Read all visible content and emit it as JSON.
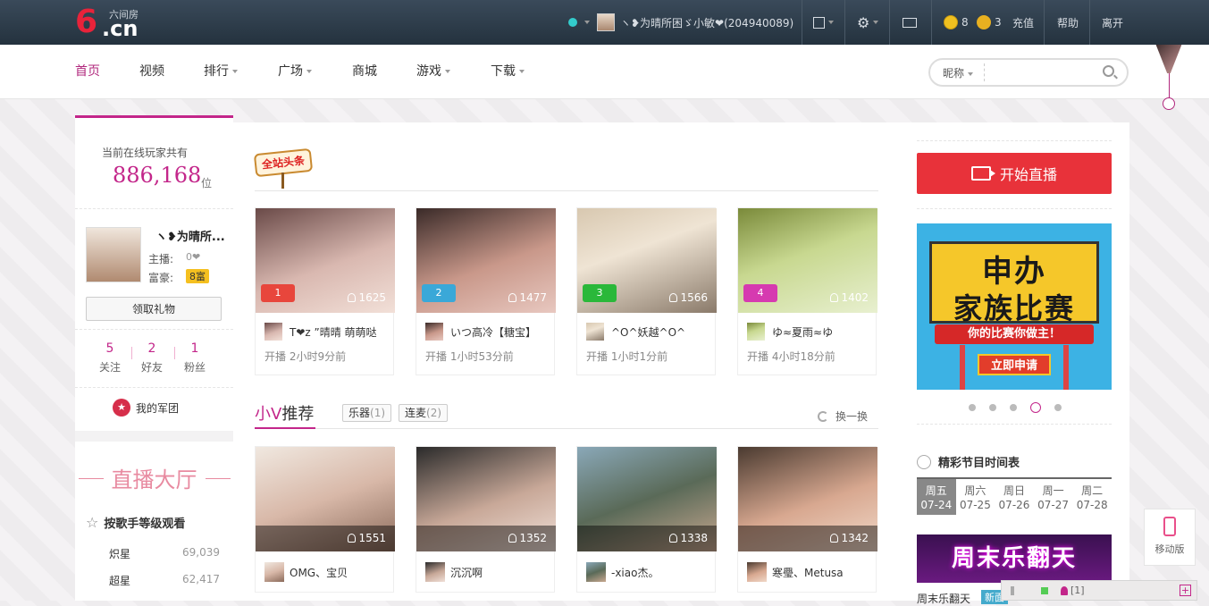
{
  "topbar": {
    "logo_big": "6",
    "logo_domain": ".cn",
    "logo_tag": "六间房",
    "username": "ヽ❥为晴所困ゞ小敏❤(204940089)",
    "coins": "8",
    "oranges": "3",
    "recharge": "充值",
    "help": "帮助",
    "leave": "离开"
  },
  "nav": {
    "items": [
      "首页",
      "视频",
      "排行",
      "广场",
      "商城",
      "游戏",
      "下载"
    ],
    "search_select": "昵称",
    "search_placeholder": ""
  },
  "left": {
    "online_label": "当前在线玩家共有",
    "online_count": "886,168",
    "online_unit": "位",
    "user_name": "ヽ❥为晴所...",
    "role_host": "主播:",
    "role_rich": "富豪:",
    "host_level": "0❤",
    "rich_level": "8富",
    "gift_button": "领取礼物",
    "follow_count": "5",
    "follow_label": "关注",
    "friend_count": "2",
    "friend_label": "好友",
    "fan_count": "1",
    "fan_label": "粉丝",
    "army": "我的军团",
    "hall_title": "直播大厅",
    "rank_title": "按歌手等级观看",
    "ranks": [
      {
        "name": "炽星",
        "value": "69,039"
      },
      {
        "name": "超星",
        "value": "62,417"
      }
    ]
  },
  "center": {
    "headline_badge": "全站头条",
    "headline_cards": [
      {
        "rank": "1",
        "viewers": "1625",
        "name": "T❤z ”晴晴 萌萌哒",
        "time": "开播 2小时9分前",
        "rank_color": "#e8463c",
        "img": "linear-gradient(160deg,#6a4a48,#d9b8b0 55%,#f2e0d8)"
      },
      {
        "rank": "2",
        "viewers": "1477",
        "name": "いつ高冷【糖宝】",
        "time": "开播 1小时53分前",
        "rank_color": "#3aa8d8",
        "img": "linear-gradient(160deg,#3a2a28,#c9988a 55%,#e8c8c0)"
      },
      {
        "rank": "3",
        "viewers": "1566",
        "name": "^O^妖越^O^",
        "time": "开播 1小时1分前",
        "rank_color": "#2ab83a",
        "img": "linear-gradient(160deg,#d8c8b0,#efe4d4 40%,#8a7a6a)"
      },
      {
        "rank": "4",
        "viewers": "1402",
        "name": "ゆ≈夏雨≈ゆ",
        "time": "开播 4小时18分前",
        "rank_color": "#d63ab0",
        "img": "linear-gradient(160deg,#7a8a3a,#c8d890 45%,#e8f0d0)"
      }
    ],
    "xv_title_a": "小V",
    "xv_title_b": "推荐",
    "tag1": "乐器",
    "tag1_count": "(1)",
    "tag2": "连麦",
    "tag2_count": "(2)",
    "refresh": "换一换",
    "xv_cards": [
      {
        "viewers": "1551",
        "name": "OMG、宝贝",
        "img": "linear-gradient(160deg,#f0e8e0,#d8b8a8 50%,#8a6a5a)"
      },
      {
        "viewers": "1352",
        "name": "沉沉啊",
        "img": "linear-gradient(160deg,#2a2a2a,#c8a898 55%,#f0e0d8)"
      },
      {
        "viewers": "1338",
        "name": "-xiao杰。",
        "img": "linear-gradient(160deg,#8aa8b8,#5a6a58 50%,#c8a890)"
      },
      {
        "viewers": "1342",
        "name": "寒璺、Metusa",
        "img": "linear-gradient(160deg,#4a3a30,#d8a890 55%,#f0d8c8)"
      }
    ]
  },
  "right": {
    "live_button": "开始直播",
    "banner_line1": "申办",
    "banner_line2": "家族比赛",
    "banner_ribbon": "你的比赛你做主！",
    "banner_apply": "立即申请",
    "schedule_title": "精彩节目时间表",
    "days": [
      {
        "week": "周五",
        "date": "07-24"
      },
      {
        "week": "周六",
        "date": "07-25"
      },
      {
        "week": "周日",
        "date": "07-26"
      },
      {
        "week": "周一",
        "date": "07-27"
      },
      {
        "week": "周二",
        "date": "07-28"
      }
    ],
    "weekend_banner": "周末乐翻天",
    "weekend_label": "周末乐翻天",
    "weekend_new": "新面"
  },
  "mobile": {
    "label": "移动版"
  },
  "statusbar": {
    "count": "[1]"
  },
  "colors": {
    "accent": "#c3268a",
    "live": "#e8323a",
    "topbar": "#2c3a48"
  }
}
